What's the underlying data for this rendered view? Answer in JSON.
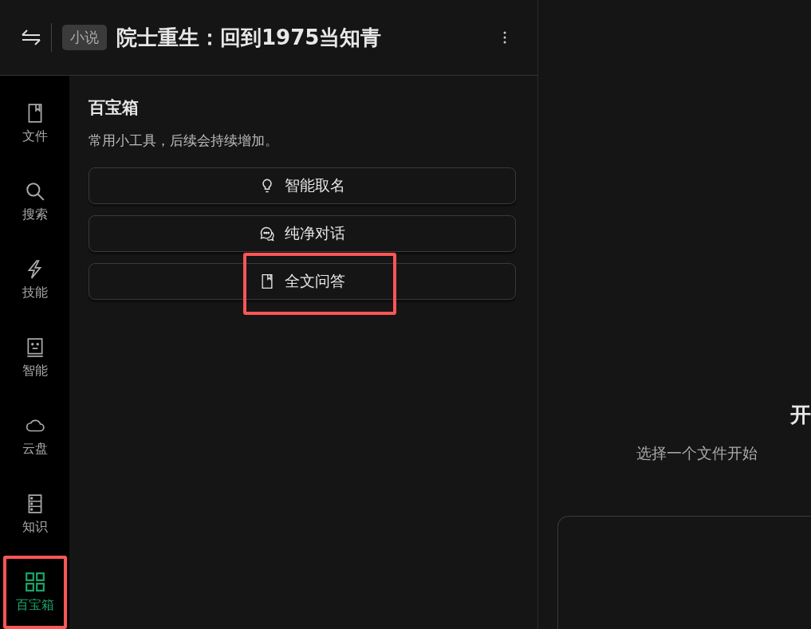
{
  "header": {
    "tag": "小说",
    "title": "院士重生：回到1975当知青"
  },
  "sidebar": {
    "items": [
      {
        "label": "文件",
        "kind": "book",
        "selected": false
      },
      {
        "label": "搜索",
        "kind": "search",
        "selected": false
      },
      {
        "label": "技能",
        "kind": "bolt",
        "selected": false
      },
      {
        "label": "智能",
        "kind": "bot",
        "selected": false
      },
      {
        "label": "云盘",
        "kind": "cloud",
        "selected": false
      },
      {
        "label": "知识",
        "kind": "server",
        "selected": false
      },
      {
        "label": "百宝箱",
        "kind": "grid",
        "selected": true,
        "highlighted": true
      }
    ]
  },
  "toolbox": {
    "title": "百宝箱",
    "subtitle": "常用小工具，后续会持续增加。",
    "tools": [
      {
        "label": "智能取名",
        "kind": "bulb",
        "highlighted": false
      },
      {
        "label": "纯净对话",
        "kind": "chat",
        "highlighted": false
      },
      {
        "label": "全文问答",
        "kind": "book",
        "highlighted": true
      }
    ]
  },
  "main": {
    "heading": "开",
    "subtitle": "选择一个文件开始"
  }
}
